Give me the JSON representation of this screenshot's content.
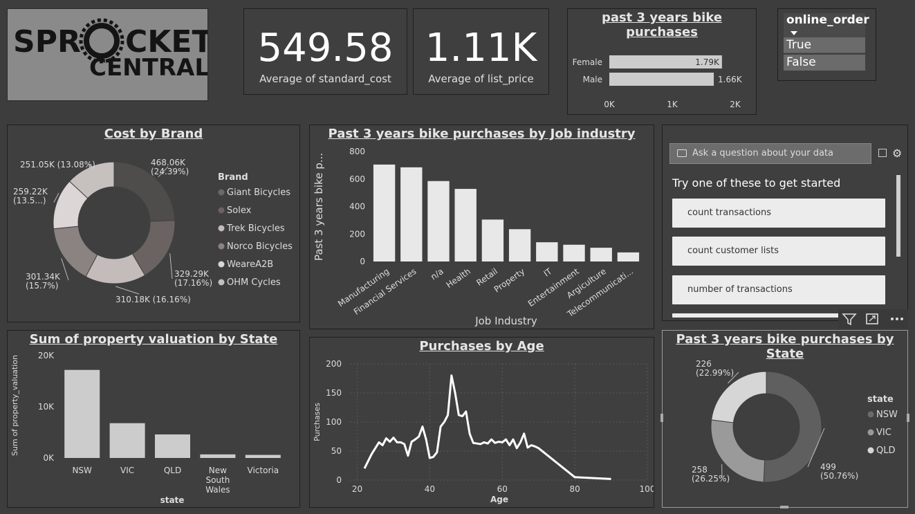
{
  "logo": {
    "line1": "SPR",
    "line1b": "CKET",
    "line2": "CENTRAL"
  },
  "kpi1": {
    "value": "549.58",
    "label": "Average of standard_cost"
  },
  "kpi2": {
    "value": "1.11K",
    "label": "Average of list_price"
  },
  "gender_chart": {
    "title": "past 3 years bike purchases",
    "chart_data": {
      "type": "bar",
      "orientation": "horizontal",
      "categories": [
        "Female",
        "Male"
      ],
      "values": [
        1790,
        1660
      ],
      "value_labels": [
        "1.79K",
        "1.66K"
      ],
      "xticks": [
        "0K",
        "1K",
        "2K"
      ],
      "xlim": [
        0,
        2000
      ]
    }
  },
  "slicer": {
    "title": "online_order",
    "options": [
      "True",
      "False"
    ]
  },
  "brand_chart": {
    "title": "Cost by Brand",
    "legend_title": "Brand",
    "chart_data": {
      "type": "pie",
      "donut": true,
      "labels": [
        "Giant Bicycles",
        "Solex",
        "Trek Bicycles",
        "Norco Bicycles",
        "WeareA2B",
        "OHM Cycles"
      ],
      "values": [
        468060,
        329290,
        310180,
        301340,
        259220,
        251050
      ],
      "slice_labels": [
        "468.06K\n(24.39%)",
        "329.29K\n(17.16%)",
        "310.18K (16.16%)",
        "301.34K\n(15.7%)",
        "259.22K\n(13.5...)",
        "251.05K (13.08%)"
      ],
      "colors": [
        "#4f4c4c",
        "#6a6361",
        "#c3bcba",
        "#8a8382",
        "#dcd6d6",
        "#c6c0bf"
      ]
    }
  },
  "job_chart": {
    "title": "Past 3 years bike purchases by Job industry",
    "chart_data": {
      "type": "bar",
      "categories": [
        "Manufacturing",
        "Financial Services",
        "n/a",
        "Health",
        "Retail",
        "Property",
        "IT",
        "Entertainment",
        "Argiculture",
        "Telecommunicati..."
      ],
      "values": [
        705,
        685,
        585,
        528,
        305,
        235,
        140,
        122,
        100,
        66
      ],
      "xlabel": "Job Industry",
      "ylabel": "Past 3 years bike p...",
      "yticks": [
        "0",
        "200",
        "400",
        "600",
        "800"
      ],
      "ylim": [
        0,
        800
      ]
    }
  },
  "qa": {
    "placeholder": "Ask a question about your data",
    "prompt": "Try one of these to get started",
    "suggestions": [
      "count transactions",
      "count customer lists",
      "number of transactions"
    ]
  },
  "property_chart": {
    "title": "Sum of property valuation by State",
    "chart_data": {
      "type": "bar",
      "categories": [
        "NSW",
        "VIC",
        "QLD",
        "New South Wales",
        "Victoria"
      ],
      "category_lines": [
        [
          "NSW"
        ],
        [
          "VIC"
        ],
        [
          "QLD"
        ],
        [
          "New",
          "South",
          "Wales"
        ],
        [
          "Victoria"
        ]
      ],
      "values": [
        17200,
        6800,
        4600,
        700,
        600
      ],
      "xlabel": "state",
      "ylabel": "Sum of property_valuation",
      "yticks": [
        "0K",
        "10K",
        "20K"
      ],
      "ylim": [
        0,
        20000
      ]
    }
  },
  "age_chart": {
    "title": "Purchases by Age",
    "chart_data": {
      "type": "line",
      "x": [
        22,
        24,
        26,
        27,
        28,
        29,
        30,
        31,
        32,
        33,
        34,
        35,
        36,
        37,
        38,
        39,
        40,
        41,
        42,
        43,
        44,
        45,
        46,
        47,
        48,
        49,
        50,
        51,
        52,
        53,
        54,
        55,
        56,
        57,
        58,
        59,
        60,
        61,
        62,
        63,
        64,
        65,
        66,
        67,
        68,
        69,
        70,
        80,
        90
      ],
      "y": [
        20,
        45,
        65,
        60,
        72,
        66,
        73,
        65,
        65,
        62,
        42,
        66,
        70,
        75,
        92,
        70,
        38,
        40,
        48,
        92,
        100,
        112,
        180,
        150,
        112,
        110,
        118,
        80,
        64,
        63,
        62,
        65,
        63,
        70,
        64,
        66,
        65,
        70,
        60,
        70,
        55,
        65,
        80,
        56,
        60,
        58,
        55,
        5,
        2
      ],
      "xlabel": "Age",
      "ylabel": "Purchases",
      "xticks": [
        "20",
        "40",
        "60",
        "80",
        "100"
      ],
      "yticks": [
        "0",
        "50",
        "100",
        "150",
        "200"
      ],
      "xlim": [
        18,
        100
      ],
      "ylim": [
        0,
        200
      ]
    }
  },
  "state_chart": {
    "title": "Past 3 years bike purchases by State",
    "legend_title": "state",
    "chart_data": {
      "type": "pie",
      "donut": true,
      "labels": [
        "NSW",
        "VIC",
        "QLD"
      ],
      "values": [
        499,
        258,
        226
      ],
      "slice_labels": [
        "499\n(50.76%)",
        "258\n(26.25%)",
        "226\n(22.99%)"
      ],
      "colors": [
        "#5f5f5f",
        "#9a9a9a",
        "#d6d6d6"
      ]
    }
  }
}
